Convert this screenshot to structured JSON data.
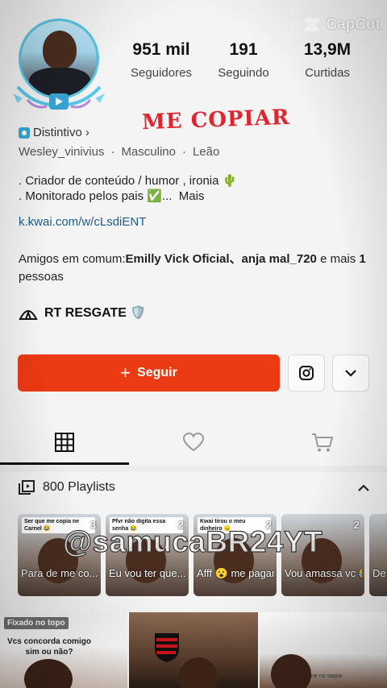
{
  "watermark_brand": "CapCut",
  "profile": {
    "stats": [
      {
        "value": "951 mil",
        "label": "Seguidores"
      },
      {
        "value": "191",
        "label": "Seguindo"
      },
      {
        "value": "13,9M",
        "label": "Curtidas"
      }
    ],
    "overlay_handwritten": "ME COPIAR",
    "badge_label": "Distintivo",
    "badge_chevron": "›",
    "username": "Wesley_vinivius",
    "gender": "Masculino",
    "sign": "Leão",
    "meta_sep": "·",
    "bio_line1": ". Criador de conteúdo / humor , ironia 🌵",
    "bio_line2": ". Monitorado pelos pais ✅...",
    "bio_more": "Mais",
    "link": "k.kwai.com/w/cLsdiENT",
    "friends_prefix": "Amigos em comum:",
    "friends_names": "Emilly Vick Oficial、anja mal_720",
    "friends_mid": " e mais ",
    "friends_count": "1",
    "friends_suffix": " pessoas",
    "community": "RT RESGATE 🛡️"
  },
  "actions": {
    "follow_icon": "+",
    "follow_label": "Seguir"
  },
  "tabs": [
    {
      "name": "grid",
      "icon": "grid-icon"
    },
    {
      "name": "likes",
      "icon": "heart-icon"
    },
    {
      "name": "shop",
      "icon": "cart-icon"
    }
  ],
  "playlists": {
    "header": "800 Playlists",
    "collapse_icon": "chevron-up-icon",
    "items": [
      {
        "caption": "Ser que me copia ne Carnel 😂",
        "count": "3",
        "title": "Para de me co...#Bro..."
      },
      {
        "caption": "Pfvr não digita essa senha 😂",
        "count": "2",
        "title": "Eu vou ter que...#Estr..."
      },
      {
        "caption": "Kwai tirou o meu dinheiro 😠",
        "count": "2",
        "title": "Afff 😮 me pagar a pedin..."
      },
      {
        "caption": "",
        "count": "2",
        "title": "Vou amassa vc 😂 ..."
      },
      {
        "caption": "",
        "count": "",
        "title": "De @C..."
      }
    ]
  },
  "overlay_watermark": "@samucaBR24YT",
  "videos": {
    "pinned_label": "Fixado no topo",
    "question": "Vcs concorda comigo sim ou não?",
    "item3_caption": "ne no saque"
  },
  "colors": {
    "accent": "#ec3a13",
    "link": "#1d5c8c",
    "overlay_red": "#e0252e"
  }
}
